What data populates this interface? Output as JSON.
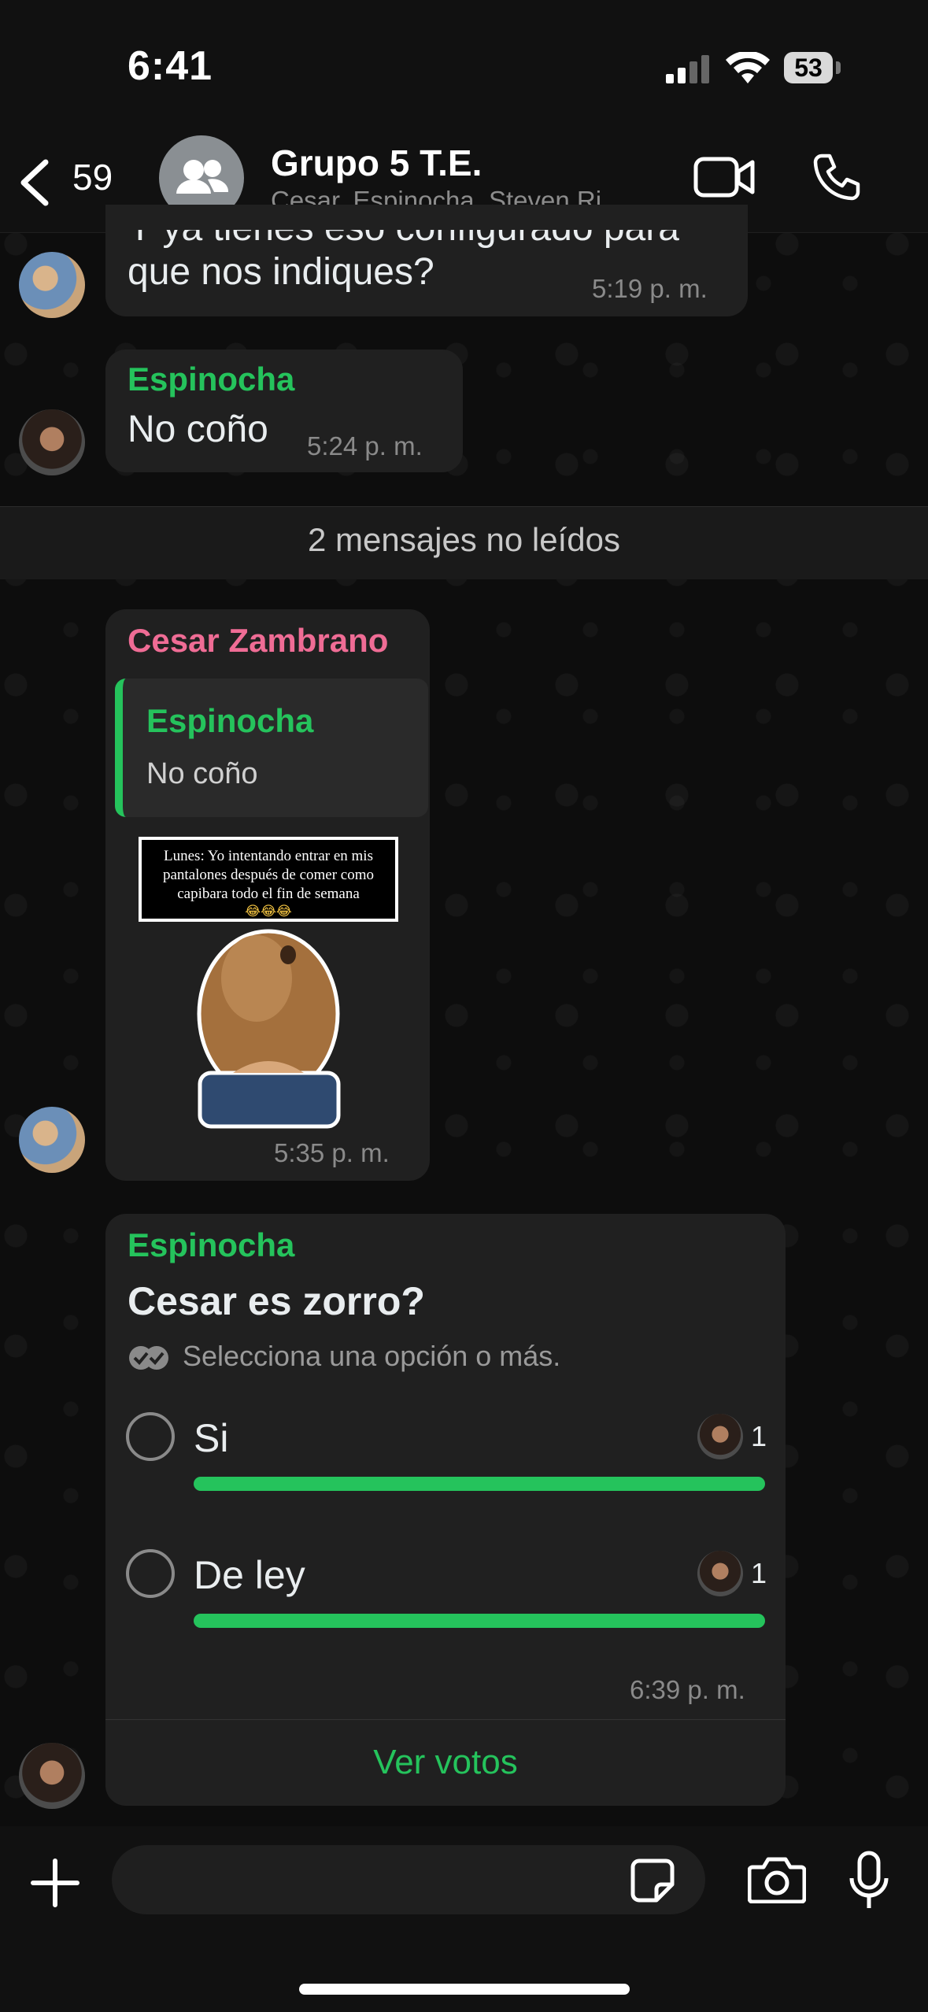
{
  "status": {
    "time": "6:41",
    "battery": "53"
  },
  "header": {
    "back_count": "59",
    "title": "Grupo 5 T.E.",
    "subtitle": "Cesar, Espinocha, Steven Ri..."
  },
  "messages": [
    {
      "sender": "",
      "text_partial": "Y ya tienes eso configurado para",
      "text": "que nos indiques?",
      "time": "5:19 p. m."
    },
    {
      "sender": "Espinocha",
      "text": "No coño",
      "time": "5:24 p. m."
    }
  ],
  "unread_label": "2 mensajes no leídos",
  "sticker_message": {
    "sender": "Cesar Zambrano",
    "quote_sender": "Espinocha",
    "quote_text": "No coño",
    "sticker_caption": "Lunes: Yo intentando entrar en mis pantalones después de comer como capibara todo el fin de semana",
    "sticker_caption_line1": "Lunes: Yo intentando entrar en mis",
    "sticker_caption_line2": "pantalones después de comer como",
    "sticker_caption_line3": "capibara todo el fin de semana",
    "sticker_emoji": "😂😂😂",
    "time": "5:35 p. m."
  },
  "poll": {
    "sender": "Espinocha",
    "question": "Cesar es zorro?",
    "hint": "Selecciona una opción o más.",
    "options": [
      {
        "label": "Si",
        "votes": "1",
        "fraction": 1.0
      },
      {
        "label": "De ley",
        "votes": "1",
        "fraction": 1.0
      }
    ],
    "time": "6:39 p. m.",
    "see_votes": "Ver votos"
  },
  "colors": {
    "accent_green": "#25c35c",
    "sender_pink": "#ef6c95",
    "bubble": "#202020"
  }
}
